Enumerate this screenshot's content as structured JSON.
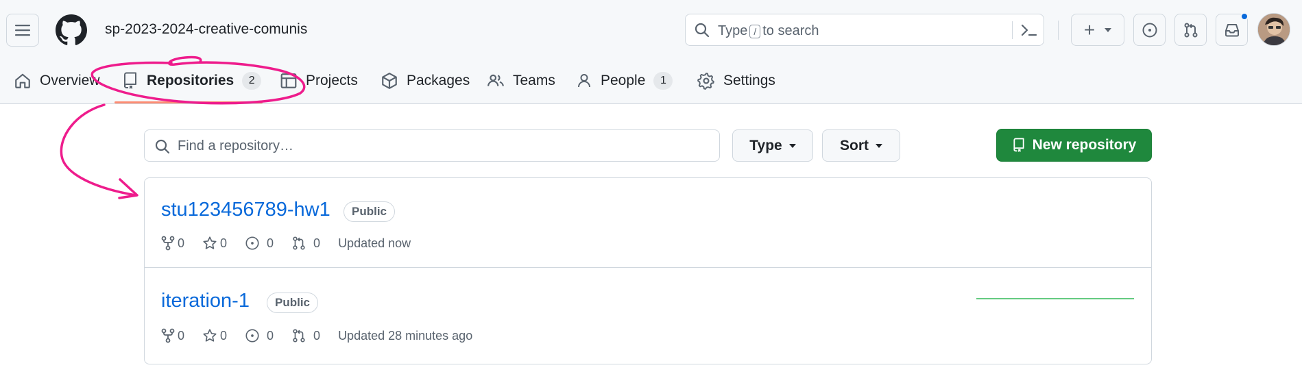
{
  "header": {
    "org_name": "sp-2023-2024-creative-comunis",
    "search": {
      "prefix": "Type",
      "key": "/",
      "suffix": "to search"
    },
    "create_label": "+",
    "icons": [
      "hamburger-icon",
      "github-logo-icon",
      "search-icon",
      "command-palette-icon",
      "plus-icon",
      "issues-icon",
      "pull-requests-icon",
      "inbox-icon",
      "avatar"
    ]
  },
  "tabs": [
    {
      "label": "Overview",
      "icon": "home-icon"
    },
    {
      "label": "Repositories",
      "icon": "repo-icon",
      "count": "2",
      "selected": true
    },
    {
      "label": "Projects",
      "icon": "table-icon"
    },
    {
      "label": "Packages",
      "icon": "package-icon"
    },
    {
      "label": "Teams",
      "icon": "people-icon"
    },
    {
      "label": "People",
      "icon": "person-icon",
      "count": "1"
    },
    {
      "label": "Settings",
      "icon": "gear-icon"
    }
  ],
  "toolbar": {
    "find_placeholder": "Find a repository…",
    "type_label": "Type",
    "sort_label": "Sort",
    "new_repo_label": "New repository"
  },
  "repos": [
    {
      "name": "stu123456789-hw1",
      "visibility": "Public",
      "forks": "0",
      "stars": "0",
      "issues": "0",
      "prs": "0",
      "updated": "Updated now"
    },
    {
      "name": "iteration-1",
      "visibility": "Public",
      "forks": "0",
      "stars": "0",
      "issues": "0",
      "prs": "0",
      "updated": "Updated 28 minutes ago"
    }
  ],
  "colors": {
    "accent": "#0969da",
    "primary_button": "#1f883d",
    "annotation": "#ee1c8c",
    "tab_underline": "#fd8c73"
  }
}
